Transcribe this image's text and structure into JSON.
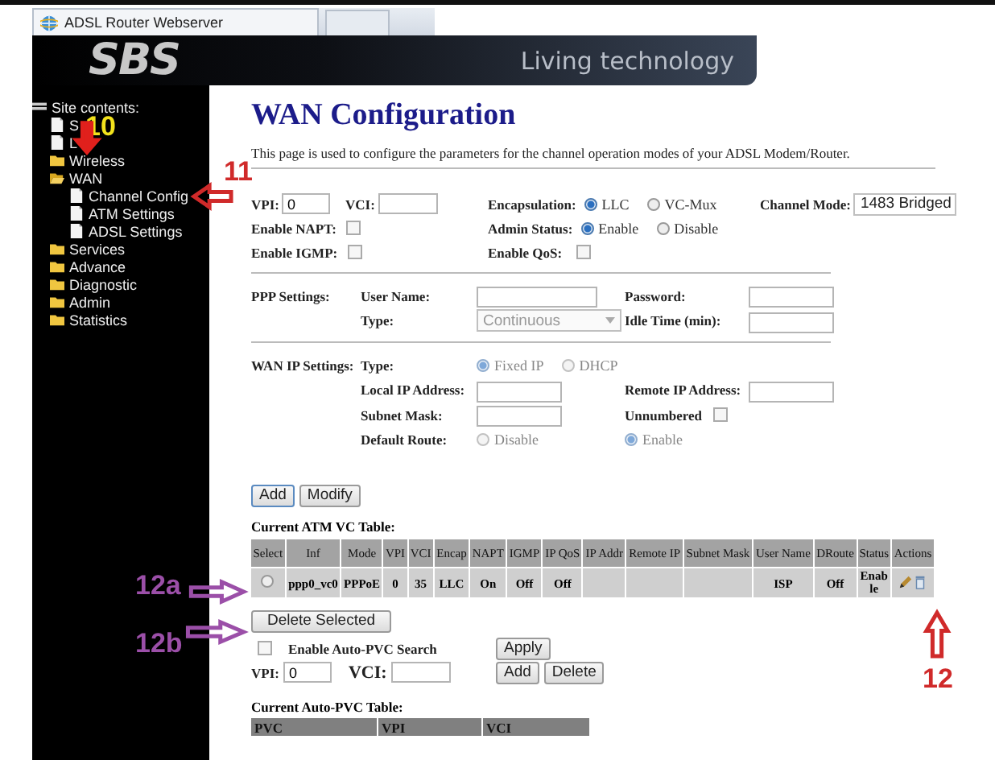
{
  "browser": {
    "tab_title": "ADSL Router Webserver"
  },
  "header": {
    "logo": "SBS",
    "tagline": "Living technology"
  },
  "sidebar": {
    "title": "Site contents:",
    "items": [
      {
        "label": "S",
        "kind": "page"
      },
      {
        "label": "L",
        "kind": "page"
      },
      {
        "label": "Wireless",
        "kind": "folder"
      },
      {
        "label": "WAN",
        "kind": "open-folder",
        "children": [
          {
            "label": "Channel Config",
            "kind": "page"
          },
          {
            "label": "ATM Settings",
            "kind": "page"
          },
          {
            "label": "ADSL Settings",
            "kind": "page"
          }
        ]
      },
      {
        "label": "Services",
        "kind": "folder"
      },
      {
        "label": "Advance",
        "kind": "folder"
      },
      {
        "label": "Diagnostic",
        "kind": "folder"
      },
      {
        "label": "Admin",
        "kind": "folder"
      },
      {
        "label": "Statistics",
        "kind": "folder"
      }
    ]
  },
  "page": {
    "title": "WAN Configuration",
    "description": "This page is used to configure the parameters for the channel operation modes of your ADSL Modem/Router."
  },
  "channel": {
    "vpi": {
      "label": "VPI:",
      "value": "0"
    },
    "vci": {
      "label": "VCI:"
    },
    "encapsulation": {
      "label": "Encapsulation:",
      "options": [
        {
          "label": "LLC",
          "selected": true
        },
        {
          "label": "VC-Mux",
          "selected": false
        }
      ]
    },
    "channel_mode": {
      "label": "Channel Mode:",
      "value": "1483 Bridged"
    },
    "enable_napt": {
      "label": "Enable NAPT:",
      "checked": false
    },
    "admin_status": {
      "label": "Admin Status:",
      "options": [
        {
          "label": "Enable",
          "selected": true
        },
        {
          "label": "Disable",
          "selected": false
        }
      ]
    },
    "enable_igmp": {
      "label": "Enable IGMP:",
      "checked": false
    },
    "enable_qos": {
      "label": "Enable QoS:",
      "checked": false
    }
  },
  "ppp": {
    "label": "PPP Settings:",
    "user_name": {
      "label": "User Name:"
    },
    "password": {
      "label": "Password:"
    },
    "type": {
      "label": "Type:",
      "value": "Continuous",
      "disabled": true
    },
    "idle_time": {
      "label": "Idle Time (min):"
    }
  },
  "wan_ip": {
    "label": "WAN IP Settings:",
    "disabled": true,
    "type": {
      "label": "Type:",
      "options": [
        {
          "label": "Fixed IP",
          "selected": true
        },
        {
          "label": "DHCP",
          "selected": false
        }
      ]
    },
    "local_ip": {
      "label": "Local IP Address:"
    },
    "remote_ip": {
      "label": "Remote IP Address:"
    },
    "subnet_mask": {
      "label": "Subnet Mask:"
    },
    "unnumbered": {
      "label": "Unnumbered",
      "checked": false
    },
    "default_route": {
      "label": "Default Route:",
      "options": [
        {
          "label": "Disable",
          "selected": false
        },
        {
          "label": "Enable",
          "selected": true
        }
      ]
    }
  },
  "form_buttons": [
    "Add",
    "Modify"
  ],
  "atm_table": {
    "title": "Current ATM VC Table:",
    "columns": [
      "Select",
      "Inf",
      "Mode",
      "VPI",
      "VCI",
      "Encap",
      "NAPT",
      "IGMP",
      "IP QoS",
      "IP Addr",
      "Remote IP",
      "Subnet Mask",
      "User Name",
      "DRoute",
      "Status",
      "Actions"
    ],
    "rows": [
      {
        "selected": false,
        "cells": [
          "",
          "ppp0_vc0",
          "PPPoE",
          "0",
          "35",
          "LLC",
          "On",
          "Off",
          "Off",
          "",
          "",
          "",
          "ISP",
          "Off",
          "Enable",
          ""
        ]
      }
    ]
  },
  "delete_selected": "Delete Selected",
  "auto_pvc": {
    "enable": {
      "label": "Enable Auto-PVC Search",
      "checked": false
    },
    "apply": "Apply",
    "vpi": {
      "label": "VPI:",
      "value": "0"
    },
    "vci": {
      "label": "VCI:"
    },
    "buttons": [
      "Add",
      "Delete"
    ],
    "table": {
      "title": "Current Auto-PVC Table:",
      "columns": [
        "PVC",
        "VPI",
        "VCI"
      ]
    }
  },
  "annotations": [
    {
      "text": "10",
      "color": "#f2e21c"
    },
    {
      "text": "11",
      "color": "#d02a2a"
    },
    {
      "text": "12a",
      "color": "#9b4fa8"
    },
    {
      "text": "12b",
      "color": "#9b4fa8"
    },
    {
      "text": "12",
      "color": "#d02a2a"
    }
  ]
}
